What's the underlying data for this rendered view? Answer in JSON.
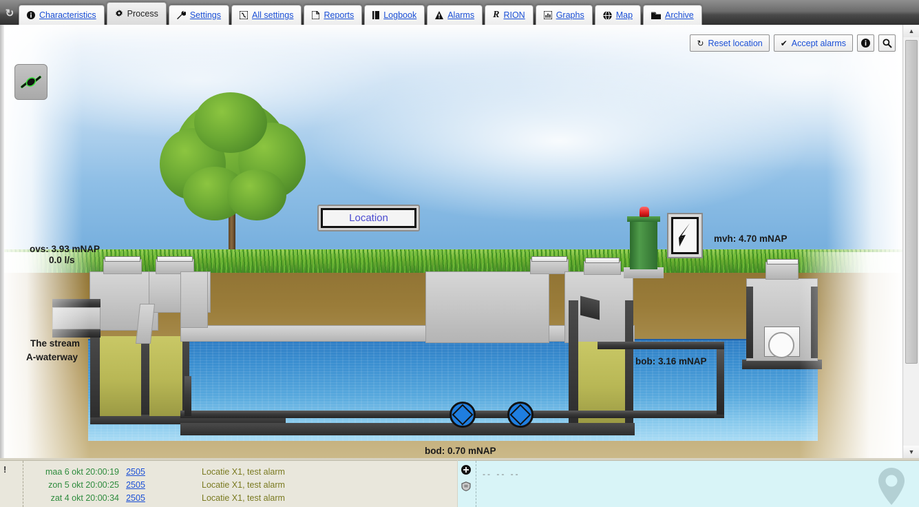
{
  "tabs": [
    {
      "label": "Characteristics",
      "icon": "info-icon",
      "active": false
    },
    {
      "label": "Process",
      "icon": "gear-icon",
      "active": true
    },
    {
      "label": "Settings",
      "icon": "wrench-icon",
      "active": false
    },
    {
      "label": "All settings",
      "icon": "sliders-icon",
      "active": false
    },
    {
      "label": "Reports",
      "icon": "document-icon",
      "active": false
    },
    {
      "label": "Logbook",
      "icon": "book-icon",
      "active": false
    },
    {
      "label": "Alarms",
      "icon": "warning-icon",
      "active": false
    },
    {
      "label": "RION",
      "icon": "r-letter-icon",
      "active": false
    },
    {
      "label": "Graphs",
      "icon": "chart-icon",
      "active": false
    },
    {
      "label": "Map",
      "icon": "globe-icon",
      "active": false
    },
    {
      "label": "Archive",
      "icon": "folder-icon",
      "active": false
    }
  ],
  "toolbar": {
    "reset_location": "Reset location",
    "accept_alarms": "Accept alarms",
    "info_icon": "info-icon",
    "search_icon": "magnifier-icon",
    "reset_icon": "refresh-icon",
    "check_icon": "check-icon"
  },
  "status_button": {
    "icon": "connected-plug-icon",
    "state_color": "#3ddc3d"
  },
  "diagram": {
    "location_label": "Location",
    "labels": {
      "ovs": "ovs: 3.93 mNAP",
      "flow": "0.0 l/s",
      "stream_line1": "The stream",
      "stream_line2": "A-waterway",
      "mvh": "mvh: 4.70 mNAP",
      "bob": "bob: 3.16 mNAP",
      "bod": "bod: 0.70 mNAP"
    },
    "pumps": [
      {
        "name": "pump-1",
        "state": "running",
        "color": "#1f7ee0"
      },
      {
        "name": "pump-2",
        "state": "running",
        "color": "#1f7ee0"
      }
    ],
    "beacon_color": "#e02020",
    "water_color": "#3a8ed0"
  },
  "log": {
    "entries": [
      {
        "timestamp": "maa 6 okt 20:00:19",
        "id": "2505",
        "message": "Locatie X1, test alarm"
      },
      {
        "timestamp": "zon 5 okt 20:00:25",
        "id": "2505",
        "message": "Locatie X1, test alarm"
      },
      {
        "timestamp": "zat 4 okt 20:00:34",
        "id": "2505",
        "message": "Locatie X1, test alarm"
      }
    ]
  },
  "right_pane": {
    "dashes": "-- -- --",
    "icons": [
      "add-circle-icon",
      "shield-icon"
    ],
    "watermark_icon": "map-pin-icon"
  }
}
